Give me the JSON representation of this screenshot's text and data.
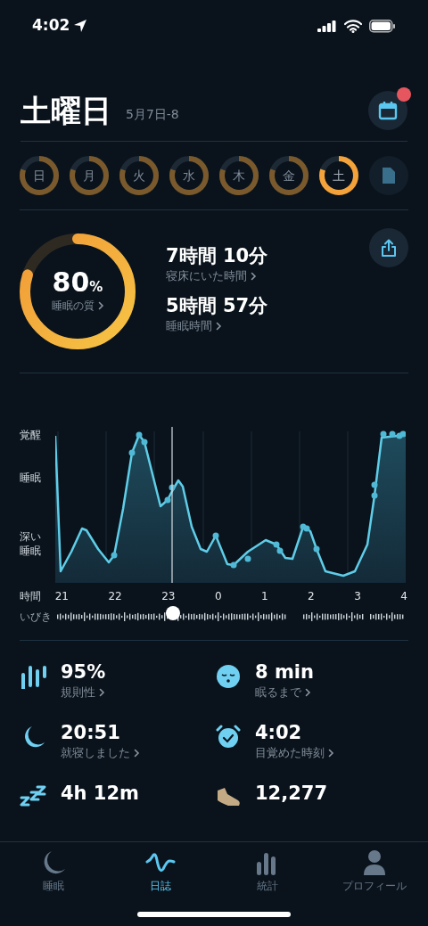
{
  "status_bar": {
    "time": "4:02"
  },
  "header": {
    "title": "土曜日",
    "date_range": "5月7日-8",
    "calendar_badge": true
  },
  "week": [
    {
      "label": "日",
      "selected": false
    },
    {
      "label": "月",
      "selected": false
    },
    {
      "label": "火",
      "selected": false
    },
    {
      "label": "水",
      "selected": false
    },
    {
      "label": "木",
      "selected": false
    },
    {
      "label": "金",
      "selected": false
    },
    {
      "label": "土",
      "selected": true
    }
  ],
  "summary": {
    "quality": {
      "value": "80",
      "unit": "%",
      "label": "睡眠の質"
    },
    "items": [
      {
        "value": "7時間 10分",
        "label": "寝床にいた時間"
      },
      {
        "value": "5時間 57分",
        "label": "睡眠時間"
      }
    ]
  },
  "hypnogram": {
    "stage_labels": [
      "覚醒",
      "睡眠",
      "深い睡眠"
    ],
    "time_label": "時間",
    "hours": [
      "21",
      "22",
      "23",
      "0",
      "1",
      "2",
      "3",
      "4"
    ],
    "snore_label": "いびき"
  },
  "stats": [
    {
      "kind": "regularity",
      "value": "95%",
      "label": "規則性"
    },
    {
      "kind": "fall_asleep",
      "value": "8 min",
      "label": "眠るまで"
    },
    {
      "kind": "bedtime",
      "value": "20:51",
      "label": "就寝しました"
    },
    {
      "kind": "wakeup",
      "value": "4:02",
      "label": "目覚めた時刻"
    },
    {
      "kind": "snore",
      "value": "4h 12m"
    },
    {
      "kind": "steps",
      "value": "12,277"
    }
  ],
  "tab_bar": [
    {
      "kind": "sleep",
      "label": "睡眠",
      "selected": false
    },
    {
      "kind": "journal",
      "label": "日誌",
      "selected": true
    },
    {
      "kind": "stats",
      "label": "統計",
      "selected": false
    },
    {
      "kind": "profile",
      "label": "プロフィール",
      "selected": false
    }
  ]
}
